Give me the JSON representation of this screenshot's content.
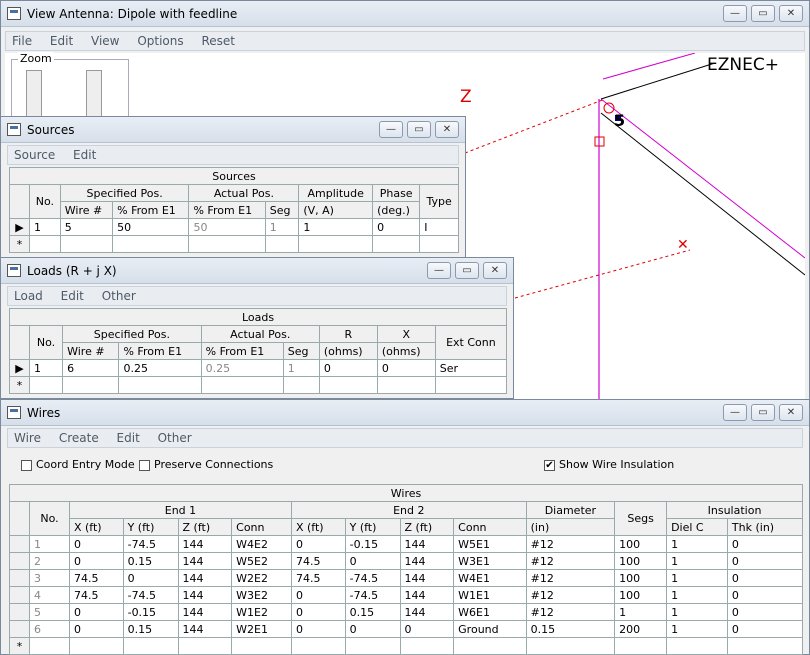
{
  "view": {
    "title": "View Antenna: Dipole with feedline",
    "menu": [
      "File",
      "Edit",
      "View",
      "Options",
      "Reset"
    ],
    "zoom_label": "Zoom",
    "brand": "EZNEC+",
    "axis_z": "Z",
    "source_marker": "5"
  },
  "sources": {
    "title": "Sources",
    "menu": [
      "Source",
      "Edit"
    ],
    "table_title": "Sources",
    "headers": [
      "No.",
      "Specified Pos.",
      "Actual Pos.",
      "Amplitude",
      "Phase",
      "Type"
    ],
    "subheaders": [
      "Wire #",
      "% From E1",
      "% From E1",
      "Seg",
      "(V, A)",
      "(deg.)"
    ],
    "rows": [
      [
        "1",
        "5",
        "50",
        "50",
        "1",
        "1",
        "0",
        "I"
      ]
    ],
    "new_row_marker": "*"
  },
  "loads": {
    "title": "Loads (R + j X)",
    "menu": [
      "Load",
      "Edit",
      "Other"
    ],
    "table_title": "Loads",
    "headers": [
      "No.",
      "Specified Pos.",
      "Actual Pos.",
      "R",
      "X",
      "Ext Conn"
    ],
    "subheaders": [
      "Wire #",
      "% From E1",
      "% From E1",
      "Seg",
      "(ohms)",
      "(ohms)"
    ],
    "rows": [
      [
        "1",
        "6",
        "0.25",
        "0.25",
        "1",
        "0",
        "0",
        "Ser"
      ]
    ],
    "new_row_marker": "*"
  },
  "wires": {
    "title": "Wires",
    "menu": [
      "Wire",
      "Create",
      "Edit",
      "Other"
    ],
    "coord_entry_label": "Coord Entry Mode",
    "coord_entry_checked": false,
    "preserve_label": "Preserve Connections",
    "preserve_checked": false,
    "insulation_label": "Show Wire Insulation",
    "insulation_checked": true,
    "check_glyph": "✔",
    "table_title": "Wires",
    "group_headers": [
      "No.",
      "End 1",
      "End 2",
      "Diameter",
      "Segs",
      "Insulation"
    ],
    "subheaders": [
      "X (ft)",
      "Y (ft)",
      "Z (ft)",
      "Conn",
      "X (ft)",
      "Y (ft)",
      "Z (ft)",
      "Conn",
      "(in)",
      "Diel C",
      "Thk (in)"
    ],
    "rows": [
      [
        "1",
        "0",
        "-74.5",
        "144",
        "W4E2",
        "0",
        "-0.15",
        "144",
        "W5E1",
        "#12",
        "100",
        "1",
        "0"
      ],
      [
        "2",
        "0",
        "0.15",
        "144",
        "W5E2",
        "74.5",
        "0",
        "144",
        "W3E1",
        "#12",
        "100",
        "1",
        "0"
      ],
      [
        "3",
        "74.5",
        "0",
        "144",
        "W2E2",
        "74.5",
        "-74.5",
        "144",
        "W4E1",
        "#12",
        "100",
        "1",
        "0"
      ],
      [
        "4",
        "74.5",
        "-74.5",
        "144",
        "W3E2",
        "0",
        "-74.5",
        "144",
        "W1E1",
        "#12",
        "100",
        "1",
        "0"
      ],
      [
        "5",
        "0",
        "-0.15",
        "144",
        "W1E2",
        "0",
        "0.15",
        "144",
        "W6E1",
        "#12",
        "1",
        "1",
        "0"
      ],
      [
        "6",
        "0",
        "0.15",
        "144",
        "W2E1",
        "0",
        "0",
        "0",
        "Ground",
        "0.15",
        "200",
        "1",
        "0"
      ]
    ],
    "new_row_marker": "*"
  },
  "window_buttons": [
    "—",
    "▭",
    "✕"
  ],
  "colors": {
    "wire_magenta": "#d000d0",
    "axis_red": "#e00000",
    "wire_black": "#000000"
  }
}
